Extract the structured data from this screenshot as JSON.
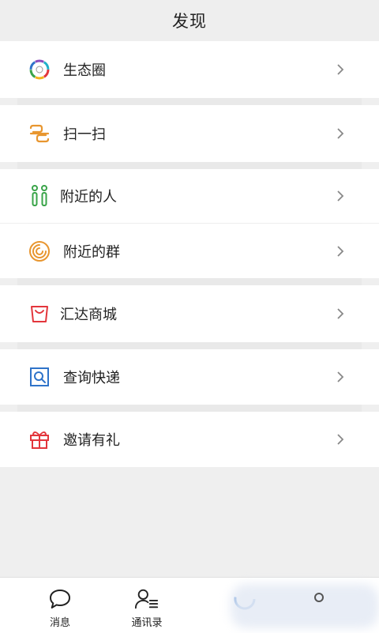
{
  "header": {
    "title": "发现"
  },
  "items": [
    {
      "label": "生态圈",
      "icon": "ecosystem-circle-icon"
    },
    {
      "label": "扫一扫",
      "icon": "scan-icon"
    },
    {
      "label": "附近的人",
      "icon": "nearby-people-icon"
    },
    {
      "label": "附近的群",
      "icon": "nearby-groups-icon"
    },
    {
      "label": "汇达商城",
      "icon": "shopping-bag-icon"
    },
    {
      "label": "查询快递",
      "icon": "express-search-icon"
    },
    {
      "label": "邀请有礼",
      "icon": "gift-icon"
    }
  ],
  "tabs": [
    {
      "label": "消息",
      "icon": "chat-bubble-icon"
    },
    {
      "label": "通讯录",
      "icon": "contacts-icon"
    },
    {
      "label": "",
      "icon": "discover-icon"
    },
    {
      "label": "",
      "icon": "profile-icon"
    }
  ],
  "colors": {
    "scan": "#e8962f",
    "nearby_people": "#3aa449",
    "nearby_groups": "#e8962f",
    "mall": "#e3363c",
    "express": "#2f73c9",
    "gift": "#e3363c",
    "chevron": "#888888"
  }
}
